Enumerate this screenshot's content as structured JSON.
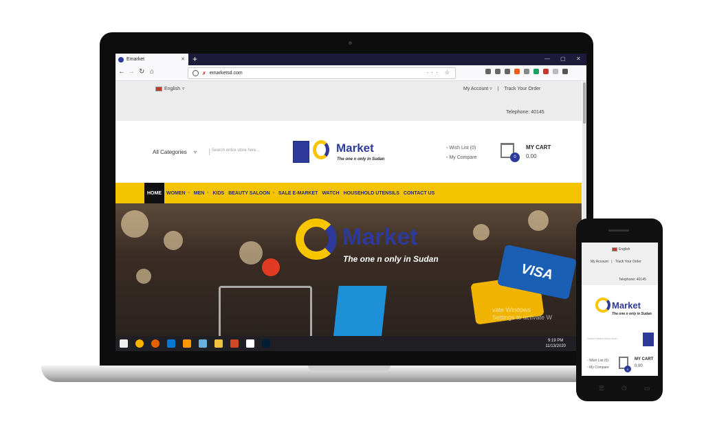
{
  "browser": {
    "tab_title": "Emarket",
    "url": "emarketsd.com"
  },
  "site": {
    "language": "English",
    "top_links": {
      "account": "My Account",
      "separator": "|",
      "track": "Track Your Order"
    },
    "telephone": "Telephone:  40145",
    "all_categories": "All Categories",
    "search_placeholder": "Search entire store here...",
    "logo": {
      "word": "Market",
      "tagline": "The one n only in Sudan"
    },
    "wishlist": "Wish List (0)",
    "compare": "My Compare",
    "cart": {
      "label": "MY CART",
      "total": "0.00",
      "count": "0"
    },
    "menu": [
      {
        "label": "HOME",
        "dropdown": false
      },
      {
        "label": "WOMEN",
        "dropdown": true
      },
      {
        "label": "MEN",
        "dropdown": true
      },
      {
        "label": "KIDS",
        "dropdown": true
      },
      {
        "label": "BEAUTY SALOON",
        "dropdown": true
      },
      {
        "label": "SALE E-MARKET",
        "dropdown": false
      },
      {
        "label": "WATCH",
        "dropdown": false
      },
      {
        "label": "HOUSEHOLD UTENSILS",
        "dropdown": false
      },
      {
        "label": "CONTACT US",
        "dropdown": false
      }
    ],
    "banner": {
      "word": "Market",
      "tagline": "The one n only in Sudan",
      "card_text": "VISA",
      "activate_line1": "vate Windows",
      "activate_line2": "Settings to activate W"
    }
  },
  "taskbar": {
    "time": "9:19 PM",
    "date": "11/13/2020"
  },
  "colors": {
    "brand_blue": "#2d3a9a",
    "brand_yellow": "#f5c400"
  }
}
